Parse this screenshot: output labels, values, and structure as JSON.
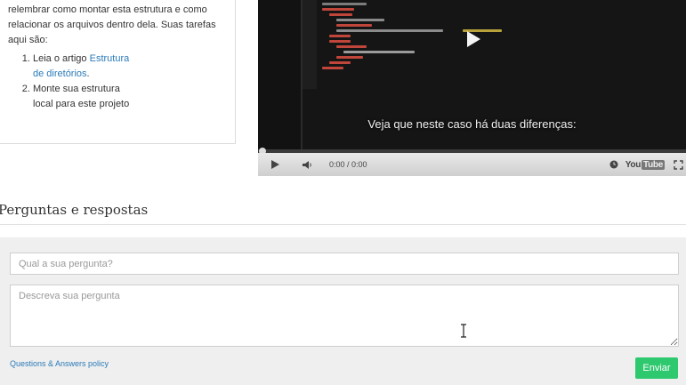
{
  "task": {
    "intro": "relembrar como montar esta estrutura e como relacionar os arquivos dentro dela. Suas tarefas aqui são:",
    "items": [
      {
        "prefix": "Leia o artigo ",
        "link": "Estrutura de diretórios",
        "suffix": "."
      },
      {
        "text": "Monte sua estrutura local para este projeto"
      }
    ]
  },
  "video": {
    "caption": "Veja que neste caso há duas diferenças:",
    "time": "0:00 / 0:00",
    "progress": 0,
    "youtube_label": "You",
    "youtube_tube": "Tube",
    "icons": [
      "play-icon",
      "volume-icon",
      "clock-icon",
      "fullscreen-icon"
    ]
  },
  "qa": {
    "title": "Perguntas e respostas",
    "question_placeholder": "Qual a sua pergunta?",
    "question_value": "",
    "description_placeholder": "Descreva sua pergunta",
    "description_value": "",
    "policy_link": "Questions & Answers policy",
    "submit_label": "Enviar"
  },
  "colors": {
    "link": "#2b7bb9",
    "submit": "#2ec86f",
    "form_bg": "#efefef"
  }
}
